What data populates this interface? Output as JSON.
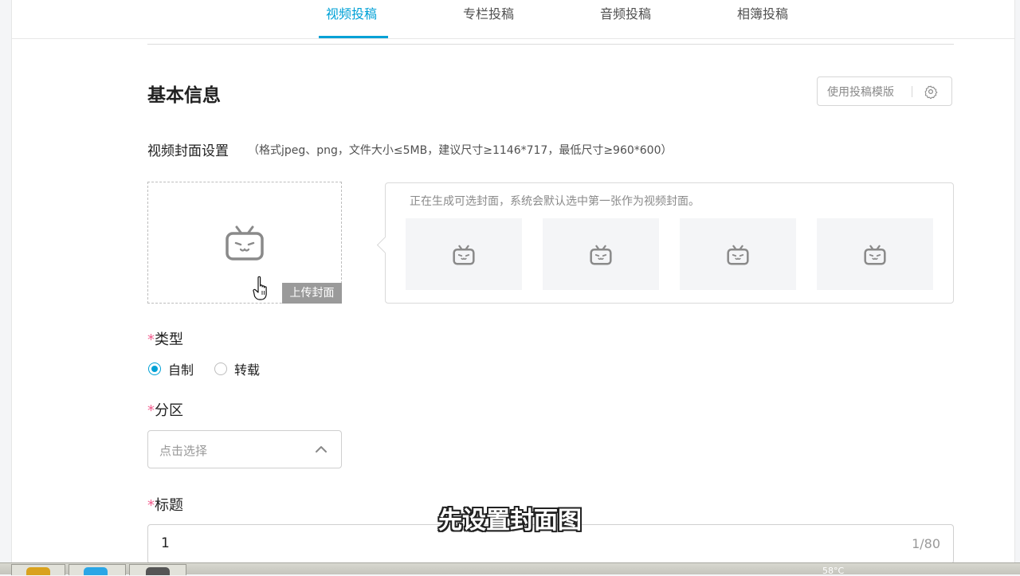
{
  "tabs": [
    {
      "label": "视频投稿",
      "active": true
    },
    {
      "label": "专栏投稿",
      "active": false
    },
    {
      "label": "音频投稿",
      "active": false
    },
    {
      "label": "相簿投稿",
      "active": false
    }
  ],
  "basic_info": {
    "title": "基本信息",
    "template_button": "使用投稿模版"
  },
  "cover": {
    "label": "视频封面设置",
    "hint": "（格式jpeg、png，文件大小≤5MB，建议尺寸≥1146*717，最低尺寸≥960*600）",
    "upload_label": "上传封面",
    "generating_text": "正在生成可选封面，系统会默认选中第一张作为视频封面。",
    "thumbnail_count": 4
  },
  "type_field": {
    "required_mark": "*",
    "label": "类型",
    "options": [
      {
        "label": "自制",
        "selected": true
      },
      {
        "label": "转载",
        "selected": false
      }
    ]
  },
  "category_field": {
    "required_mark": "*",
    "label": "分区",
    "placeholder": "点击选择"
  },
  "title_field": {
    "required_mark": "*",
    "label": "标题",
    "value": "1",
    "counter": "1/80"
  },
  "subtitle_overlay": "先设置封面图",
  "taskbar": {
    "tray_text": "58°C"
  },
  "colors": {
    "accent": "#00a1d6",
    "required": "#f25d8e"
  }
}
